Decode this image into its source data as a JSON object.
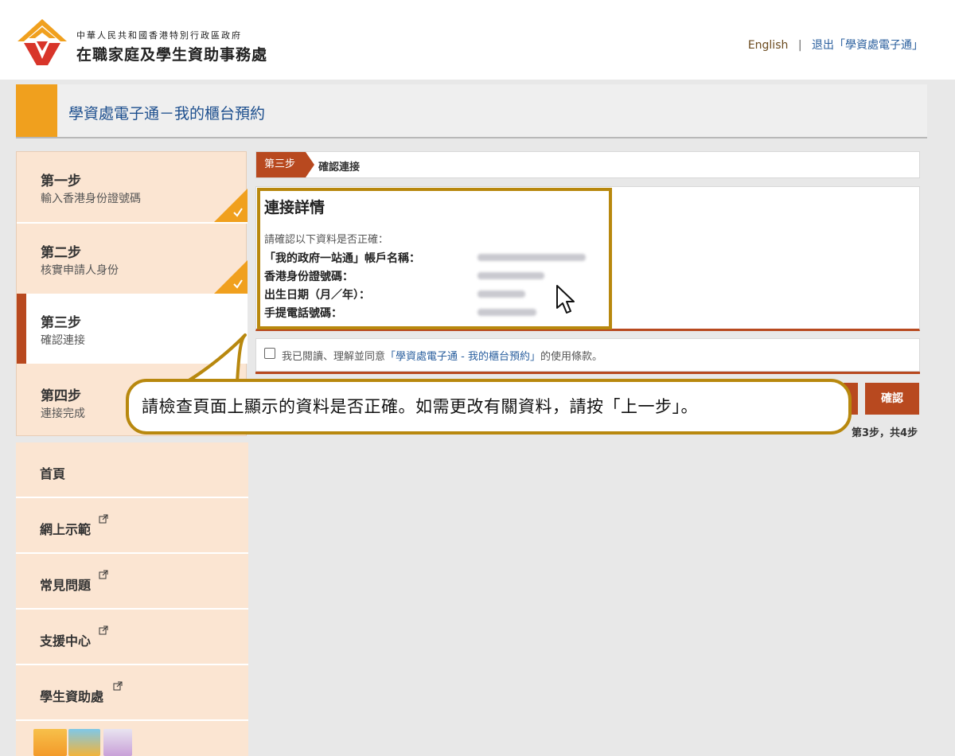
{
  "header": {
    "org_sub": "中華人民共和國香港特別行政區政府",
    "org_main": "在職家庭及學生資助事務處",
    "lang_link": "English",
    "separator": "|",
    "logout_link": "退出「學資處電子通」"
  },
  "banner": {
    "title": "學資處電子通－我的櫃台預約"
  },
  "steps": [
    {
      "title": "第一步",
      "desc": "輸入香港身份證號碼",
      "done": true
    },
    {
      "title": "第二步",
      "desc": "核實申請人身份",
      "done": true
    },
    {
      "title": "第三步",
      "desc": "確認連接",
      "active": true
    },
    {
      "title": "第四步",
      "desc": "連接完成"
    }
  ],
  "menu": {
    "items": [
      {
        "label": "首頁",
        "external": false
      },
      {
        "label": "網上示範",
        "external": true
      },
      {
        "label": "常見問題",
        "external": true
      },
      {
        "label": "支援中心",
        "external": true
      },
      {
        "label": "學生資助處",
        "external": true
      }
    ]
  },
  "stepbar": {
    "step_label": "第三步",
    "step_name": "確認連接"
  },
  "details": {
    "title": "連接詳情",
    "intro": "請確認以下資料是否正確：",
    "rows": [
      {
        "label": "「我的政府一站通」帳戶名稱："
      },
      {
        "label": "香港身份證號碼："
      },
      {
        "label": "出生日期（月／年）："
      },
      {
        "label": "手提電話號碼："
      }
    ]
  },
  "agreement": {
    "prefix": "我已閱讀、理解並同意",
    "link": "「學資處電子通 - 我的櫃台預約」",
    "suffix": "的使用條款。"
  },
  "actions": {
    "confirm": "確認",
    "page_count": "第3步，共4步"
  },
  "callout": {
    "text": "請檢查頁面上顯示的資料是否正確。如需更改有關資料，請按「上一步」。"
  },
  "colors": {
    "accent": "#b8491f",
    "orange": "#f0a01e",
    "highlight": "#b8880e",
    "link": "#2a5f9e"
  }
}
